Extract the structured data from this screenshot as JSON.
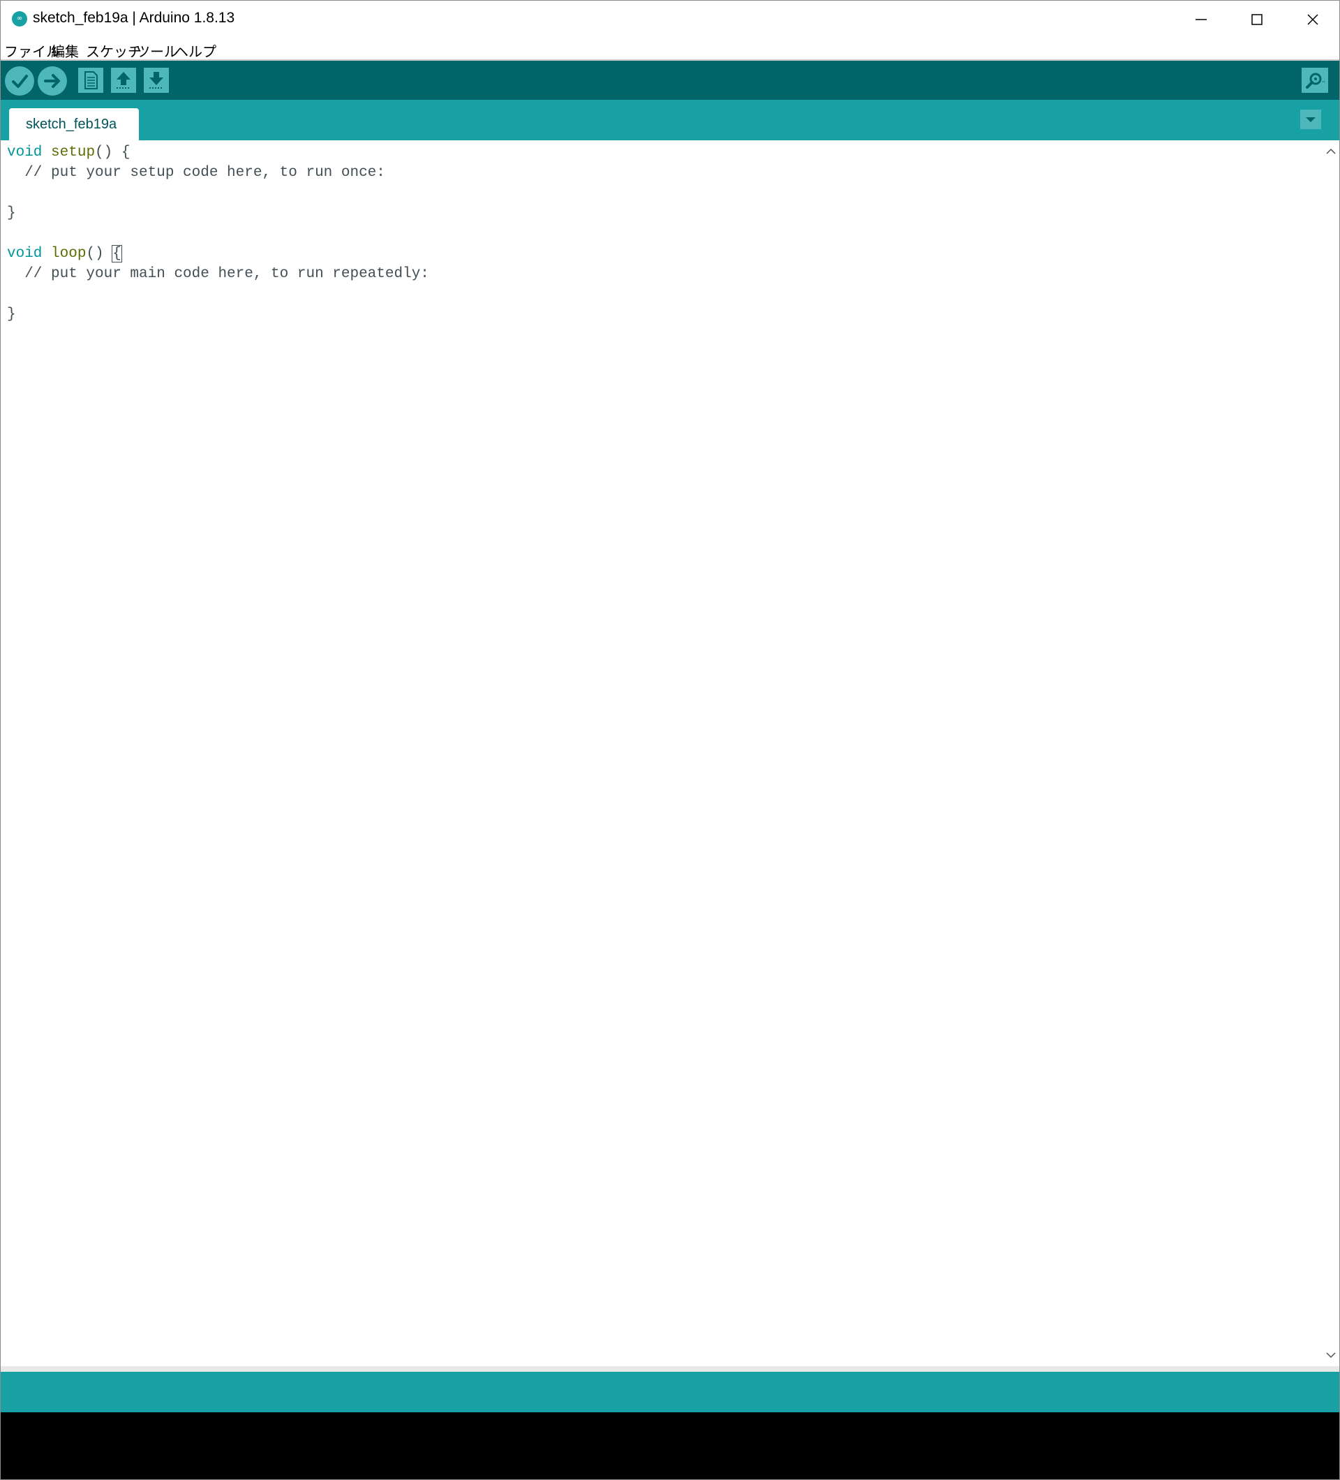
{
  "window": {
    "title": "sketch_feb19a | Arduino 1.8.13",
    "logo_glyph": "∞"
  },
  "menu": {
    "items": [
      "ファイル",
      "編集",
      "スケッチ",
      "ツール",
      "ヘルプ"
    ]
  },
  "toolbar": {
    "buttons": [
      {
        "name": "verify",
        "icon": "check-icon"
      },
      {
        "name": "upload",
        "icon": "arrow-right-icon"
      },
      {
        "name": "new",
        "icon": "new-file-icon"
      },
      {
        "name": "open",
        "icon": "arrow-up-icon"
      },
      {
        "name": "save",
        "icon": "arrow-down-icon"
      },
      {
        "name": "serial-monitor",
        "icon": "magnifier-icon"
      }
    ]
  },
  "tabs": {
    "active": "sketch_feb19a"
  },
  "editor": {
    "lines": [
      {
        "type": "void",
        "fn": "setup",
        "rest": "() {"
      },
      {
        "comment": "  // put your setup code here, to run once:"
      },
      {
        "blank": ""
      },
      {
        "close": "}"
      },
      {
        "blank": ""
      },
      {
        "type": "void",
        "fn": "loop",
        "rest": "() ",
        "brace": "{"
      },
      {
        "comment": "  // put your main code here, to run repeatedly:"
      },
      {
        "blank": ""
      },
      {
        "close": "}"
      }
    ]
  },
  "colors": {
    "toolbar_bg": "#006468",
    "tabbar_bg": "#17a1a5",
    "button_bg": "#4db7bb",
    "keyword": "#00979c",
    "function": "#5e6d03",
    "text": "#434f54",
    "console_bg": "#000000"
  }
}
